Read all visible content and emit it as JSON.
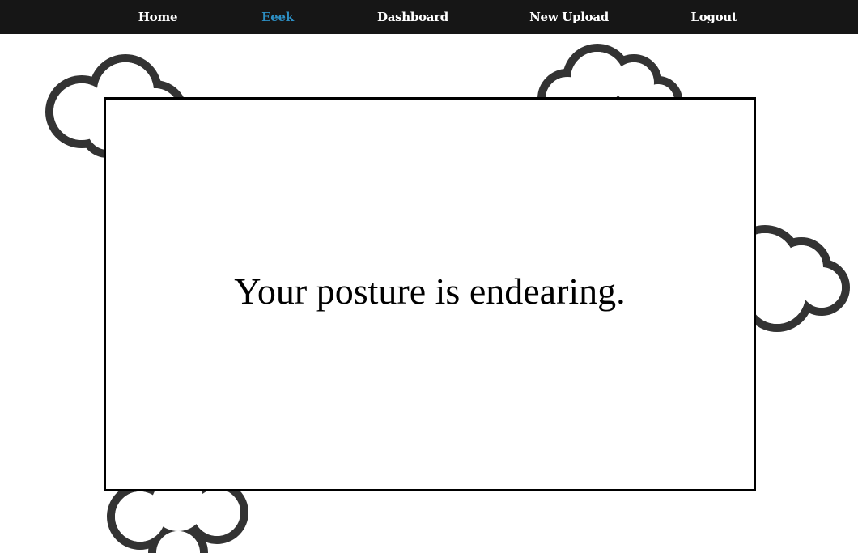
{
  "nav": {
    "items": [
      {
        "label": "Home",
        "active": false
      },
      {
        "label": "Eeek",
        "active": true
      },
      {
        "label": "Dashboard",
        "active": false
      },
      {
        "label": "New Upload",
        "active": false
      },
      {
        "label": "Logout",
        "active": false
      }
    ]
  },
  "card": {
    "message": "Your posture is endearing."
  },
  "colors": {
    "navbar_bg": "#161616",
    "nav_text": "#ffffff",
    "nav_active": "#2d8fc4",
    "cloud_stroke": "#333333",
    "card_border": "#000000"
  },
  "decor": {
    "clouds": [
      "cloud-outline-icon",
      "cloud-outline-icon",
      "cloud-outline-icon",
      "cloud-outline-icon"
    ]
  }
}
